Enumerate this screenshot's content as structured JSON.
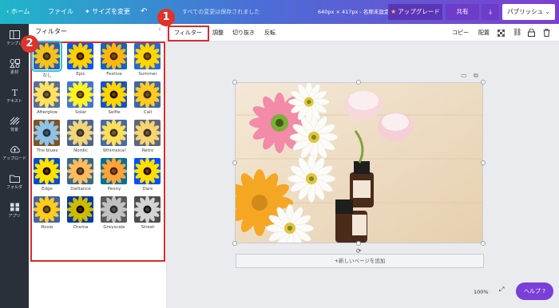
{
  "topbar": {
    "home": "ホーム",
    "file": "ファイル",
    "resize": "サイズを変更",
    "saved": "すべての変更は保存されました",
    "doc_info": "640px × 417px - 名称未設定",
    "upgrade": "アップグレード",
    "share": "共有",
    "publish": "パブリッシュ"
  },
  "rail": [
    {
      "label": "テンプレ",
      "icon": "template-icon"
    },
    {
      "label": "素材",
      "icon": "elements-icon"
    },
    {
      "label": "テキスト",
      "icon": "text-icon"
    },
    {
      "label": "背景",
      "icon": "background-icon"
    },
    {
      "label": "アップロード",
      "icon": "upload-icon"
    },
    {
      "label": "フォルダ",
      "icon": "folder-icon"
    },
    {
      "label": "アプリ",
      "icon": "apps-icon"
    }
  ],
  "panel": {
    "title": "フィルター",
    "filters": [
      "なし",
      "Epic",
      "Festive",
      "Summer",
      "Afterglow",
      "Solar",
      "Selfie",
      "Cali",
      "The blues",
      "Nordic",
      "Whimsical",
      "Retro",
      "Edge",
      "Dalliance",
      "Peony",
      "Dare",
      "Rosie",
      "Drama",
      "Greyscale",
      "Street"
    ]
  },
  "toolbar": {
    "filter": "フィルター",
    "adjust": "調整",
    "crop": "切り抜き",
    "flip": "反転",
    "copy": "コピー",
    "arrange": "配置"
  },
  "canvas": {
    "add_page": "+新しいページを追加",
    "zoom": "100%",
    "help": "ヘルプ ?"
  },
  "annotations": {
    "badge1": "1",
    "badge2": "2"
  },
  "colors": {
    "accent": "#2ec4d6",
    "annotation": "#d92b2b",
    "help": "#7a3fd8"
  }
}
